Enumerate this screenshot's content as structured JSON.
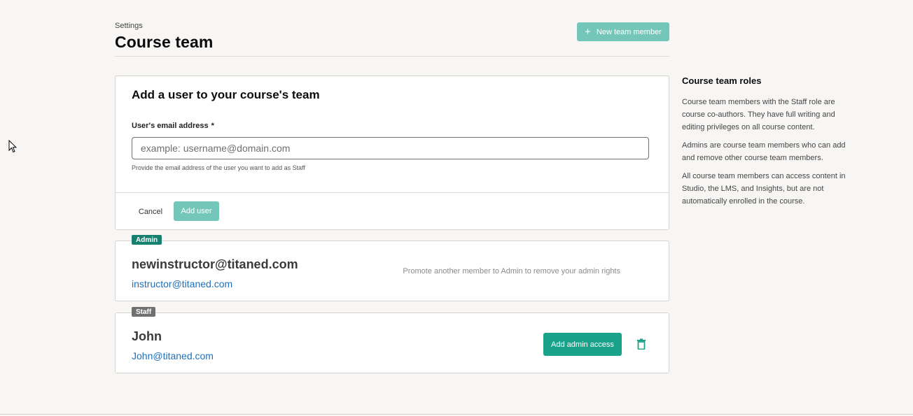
{
  "header": {
    "breadcrumb": "Settings",
    "title": "Course team",
    "new_member_label": "New team member"
  },
  "add_user_form": {
    "title": "Add a user to your course's team",
    "email_label": "User's email address",
    "required_marker": "*",
    "email_placeholder": "example: username@domain.com",
    "email_value": "",
    "helper_text": "Provide the email address of the user you want to add as Staff",
    "cancel_label": "Cancel",
    "submit_label": "Add user"
  },
  "members": [
    {
      "role": "Admin",
      "name": "newinstructor@titaned.com",
      "email": "instructor@titaned.com",
      "hint": "Promote another member to Admin to remove your admin rights"
    },
    {
      "role": "Staff",
      "name": "John",
      "email": "John@titaned.com",
      "action_label": "Add admin access",
      "delete_icon": "trash-icon"
    }
  ],
  "sidebar": {
    "title": "Course team roles",
    "paragraphs": [
      "Course team members with the Staff role are course co-authors. They have full writing and editing privileges on all course content.",
      "Admins are course team members who can add and remove other course team members.",
      "All course team members can access content in Studio, the LMS, and Insights, but are not automatically enrolled in the course."
    ]
  },
  "colors": {
    "primary": "#1ba28b",
    "primary_disabled": "#74c7b8",
    "admin_badge": "#18806f",
    "staff_badge": "#707070",
    "link": "#1e6fb8"
  }
}
